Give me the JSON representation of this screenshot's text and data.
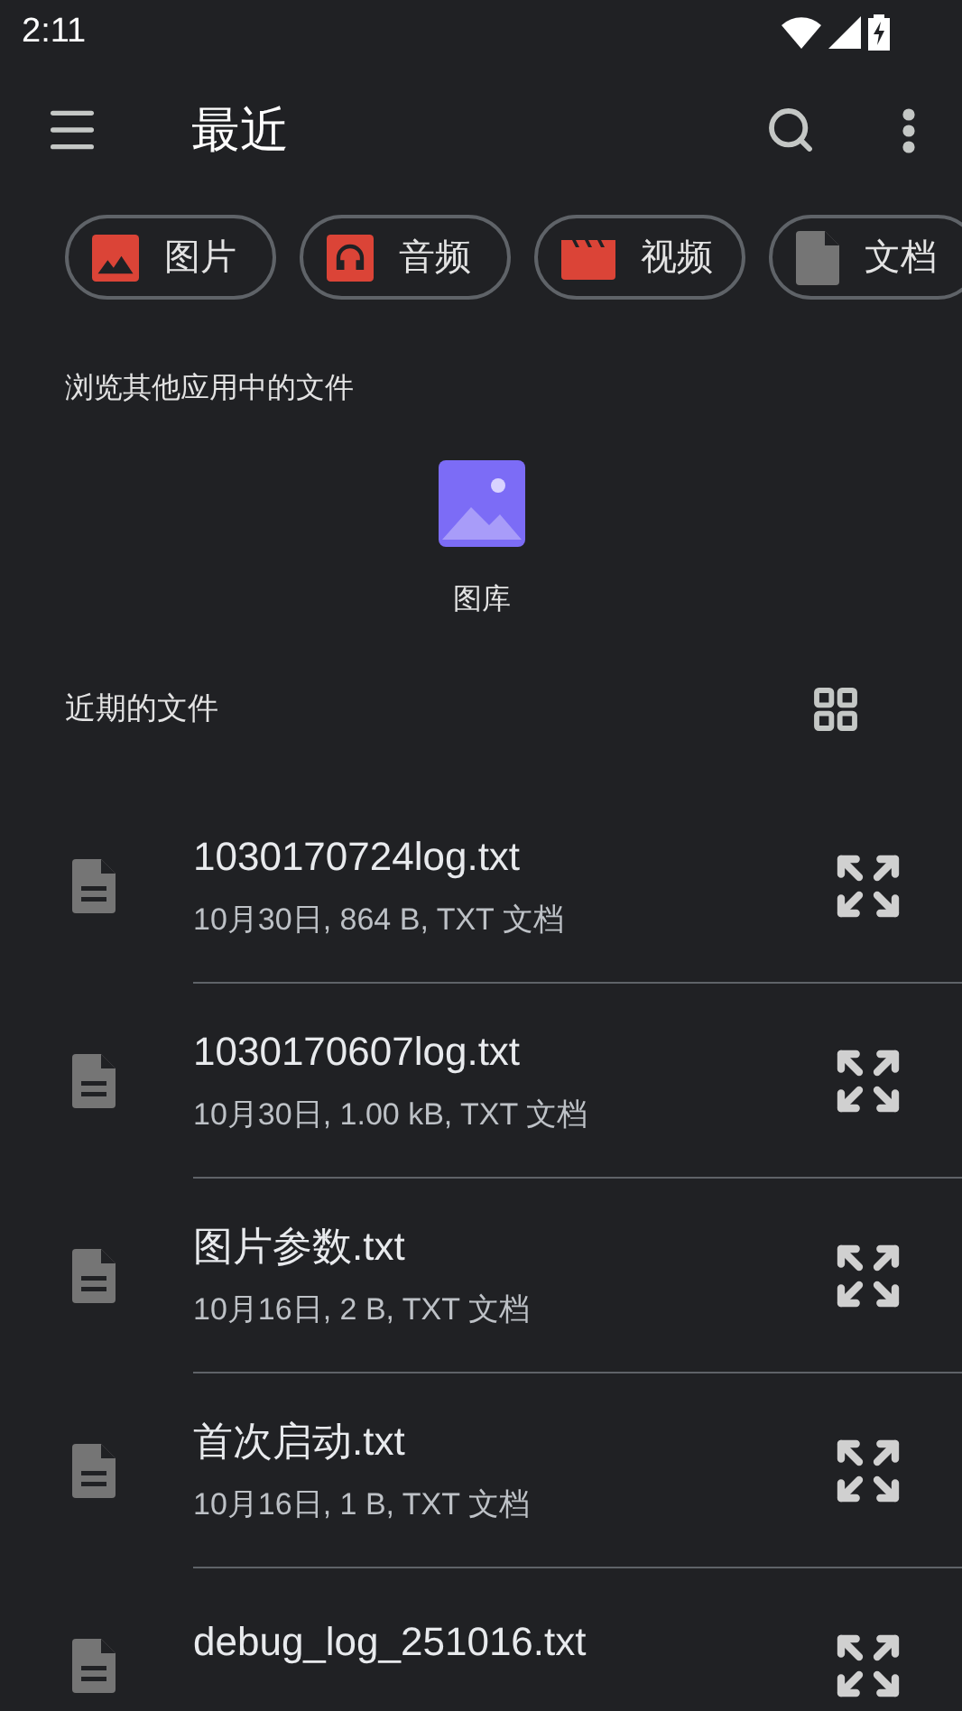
{
  "status_bar": {
    "time": "2:11"
  },
  "toolbar": {
    "title": "最近"
  },
  "chips": [
    {
      "label": "图片",
      "kind": "image"
    },
    {
      "label": "音频",
      "kind": "audio"
    },
    {
      "label": "视频",
      "kind": "video"
    },
    {
      "label": "文档",
      "kind": "document"
    }
  ],
  "other_apps": {
    "heading": "浏览其他应用中的文件",
    "apps": [
      {
        "label": "图库"
      }
    ]
  },
  "recent": {
    "heading": "近期的文件"
  },
  "files": [
    {
      "name": "1030170724log.txt",
      "details": "10月30日, 864 B, TXT 文档"
    },
    {
      "name": "1030170607log.txt",
      "details": "10月30日, 1.00 kB, TXT 文档"
    },
    {
      "name": "图片参数.txt",
      "details": "10月16日, 2 B, TXT 文档"
    },
    {
      "name": "首次启动.txt",
      "details": "10月16日, 1 B, TXT 文档"
    },
    {
      "name": "debug_log_251016.txt"
    }
  ]
}
